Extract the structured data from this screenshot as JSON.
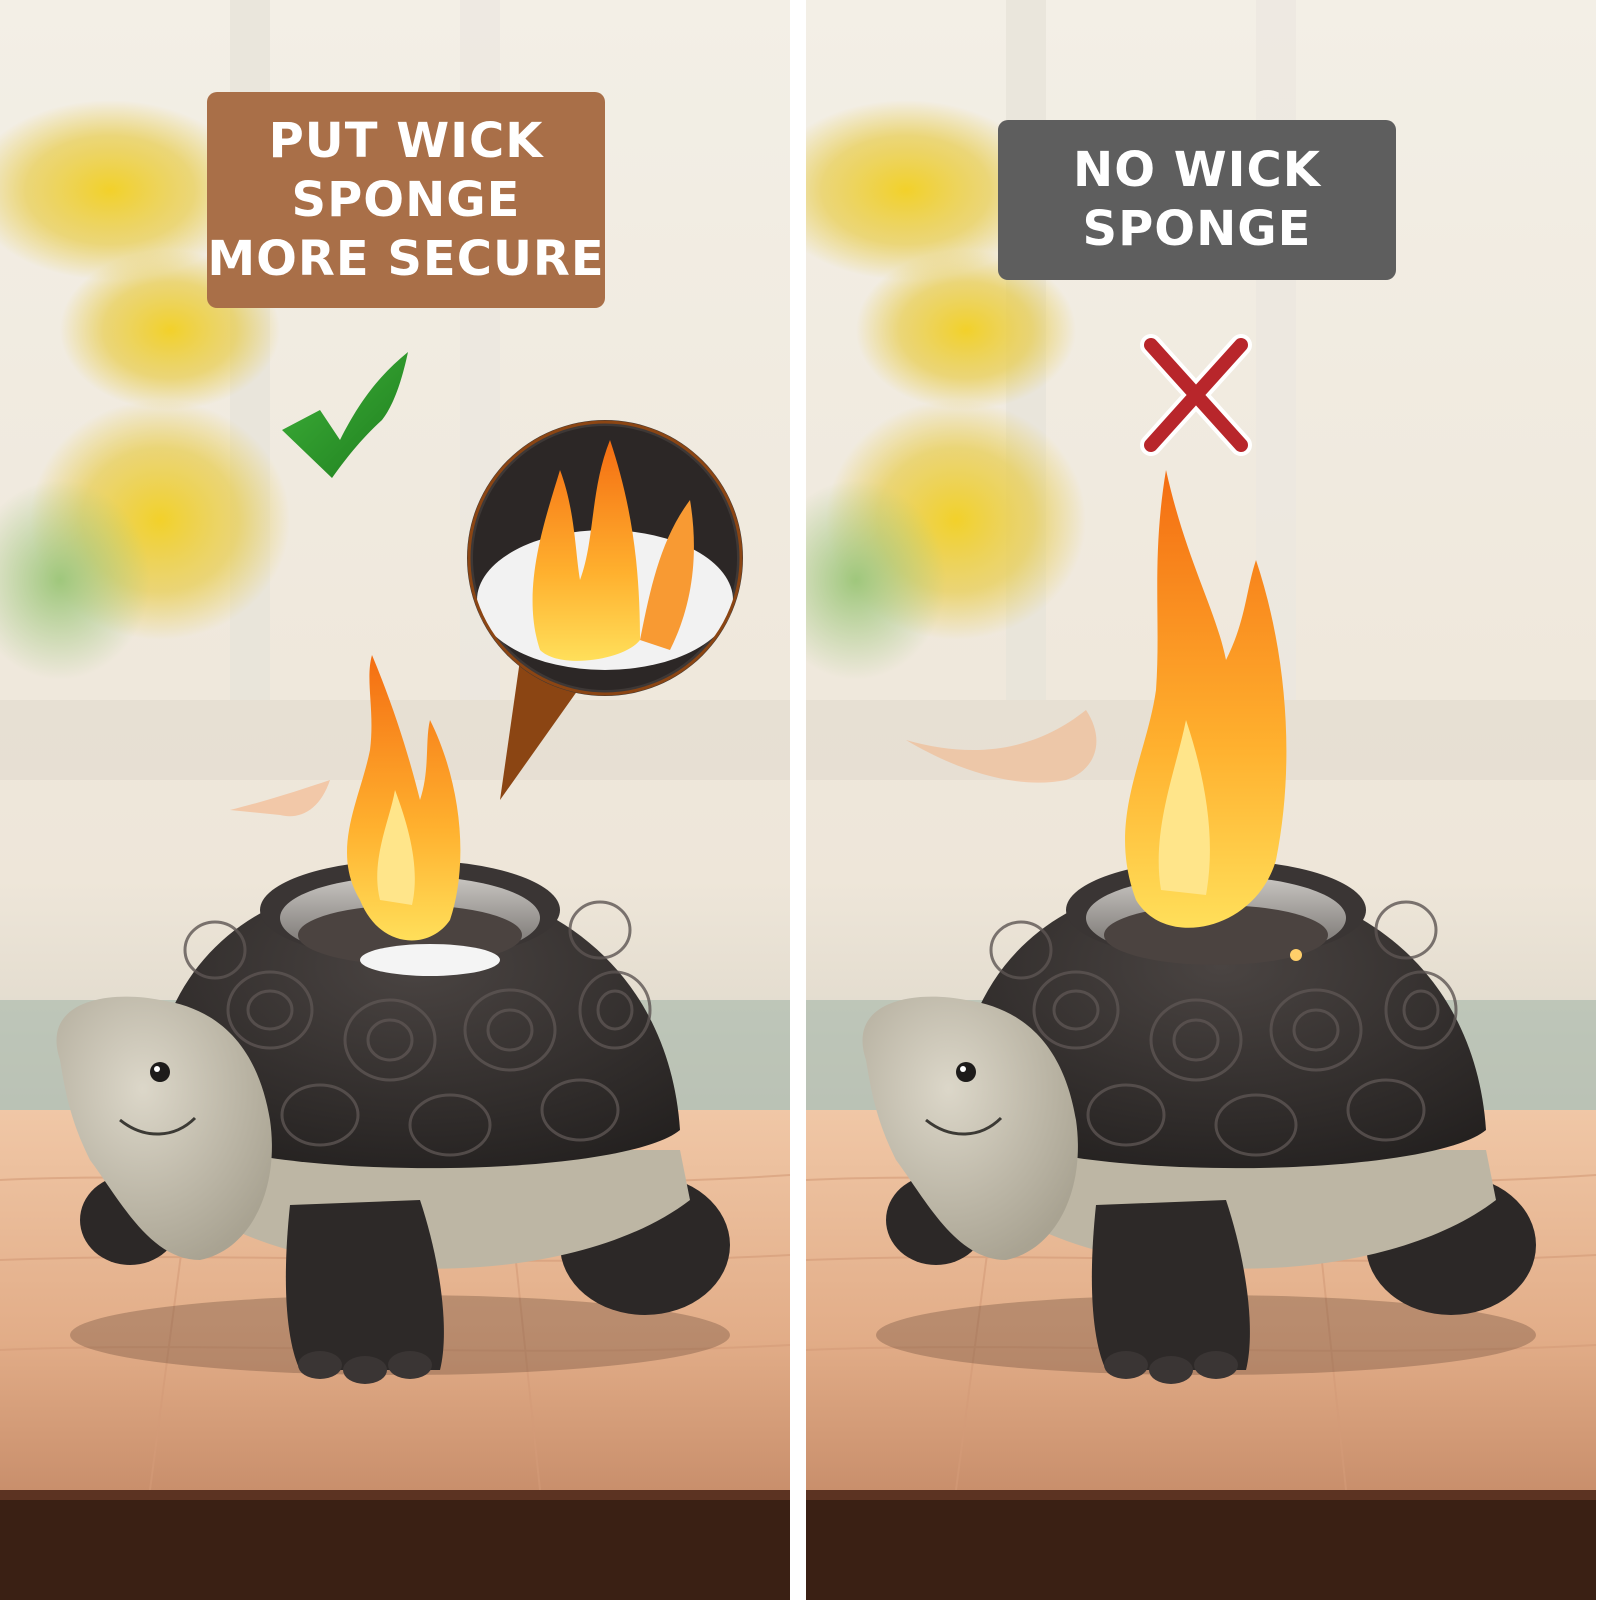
{
  "colors": {
    "good_label_bg": "#a96f48",
    "bad_label_bg": "#5e5e5e",
    "check_green": "#2e9a2a",
    "cross_red": "#b8262b",
    "flame_orange": "#f7891e",
    "flame_yellow": "#ffd34a",
    "shell_dark": "#2f2b2a",
    "head_stone": "#c9c3b3",
    "table_wood": "#e8b995"
  },
  "panels": {
    "with_sponge": {
      "label_lines": [
        "PUT WICK",
        "SPONGE",
        "MORE SECURE"
      ],
      "mark_icon": "check-icon"
    },
    "without_sponge": {
      "label_lines": [
        "NO WICK",
        "SPONGE"
      ],
      "mark_icon": "cross-icon"
    }
  }
}
